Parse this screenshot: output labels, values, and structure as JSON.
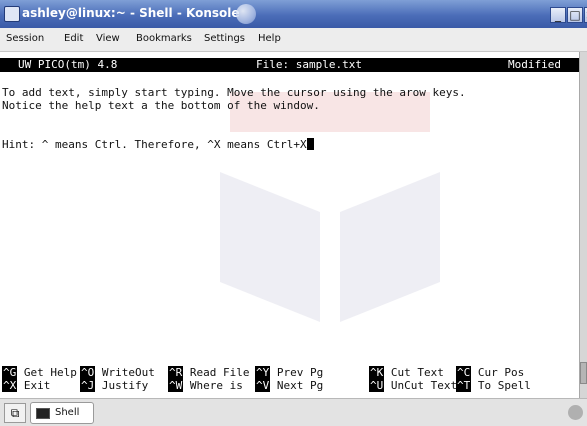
{
  "window": {
    "title": "ashley@linux:~ - Shell - Konsole",
    "buttons": {
      "minimize": "_",
      "maximize": "□",
      "close": "×"
    }
  },
  "menubar": {
    "items": [
      "Session",
      "Edit",
      "View",
      "Bookmarks",
      "Settings",
      "Help"
    ]
  },
  "editor": {
    "app_name": "UW PICO(tm) 4.8",
    "file_label": "File: sample.txt",
    "status": "Modified",
    "lines": [
      "To add text, simply start typing. Move the cursor using the arow keys.",
      "Notice the help text a the bottom of the window.",
      "",
      "Hint: ^ means Ctrl. Therefore, ^X means Ctrl+X"
    ]
  },
  "shortcuts": {
    "row1": [
      {
        "key": "^G",
        "label": "Get Help"
      },
      {
        "key": "^O",
        "label": "WriteOut"
      },
      {
        "key": "^R",
        "label": "Read File"
      },
      {
        "key": "^Y",
        "label": "Prev Pg"
      },
      {
        "key": "^K",
        "label": "Cut Text"
      },
      {
        "key": "^C",
        "label": "Cur Pos"
      }
    ],
    "row2": [
      {
        "key": "^X",
        "label": "Exit"
      },
      {
        "key": "^J",
        "label": "Justify"
      },
      {
        "key": "^W",
        "label": "Where is"
      },
      {
        "key": "^V",
        "label": "Next Pg"
      },
      {
        "key": "^U",
        "label": "UnCut Text"
      },
      {
        "key": "^T",
        "label": "To Spell"
      }
    ]
  },
  "tabbar": {
    "new_tab_icon": "new-tab-icon",
    "tabs": [
      {
        "label": "Shell"
      }
    ]
  },
  "colors": {
    "titlebar": "#4b6db8",
    "terminal_bg": "#ffffff",
    "terminal_fg": "#111111"
  }
}
